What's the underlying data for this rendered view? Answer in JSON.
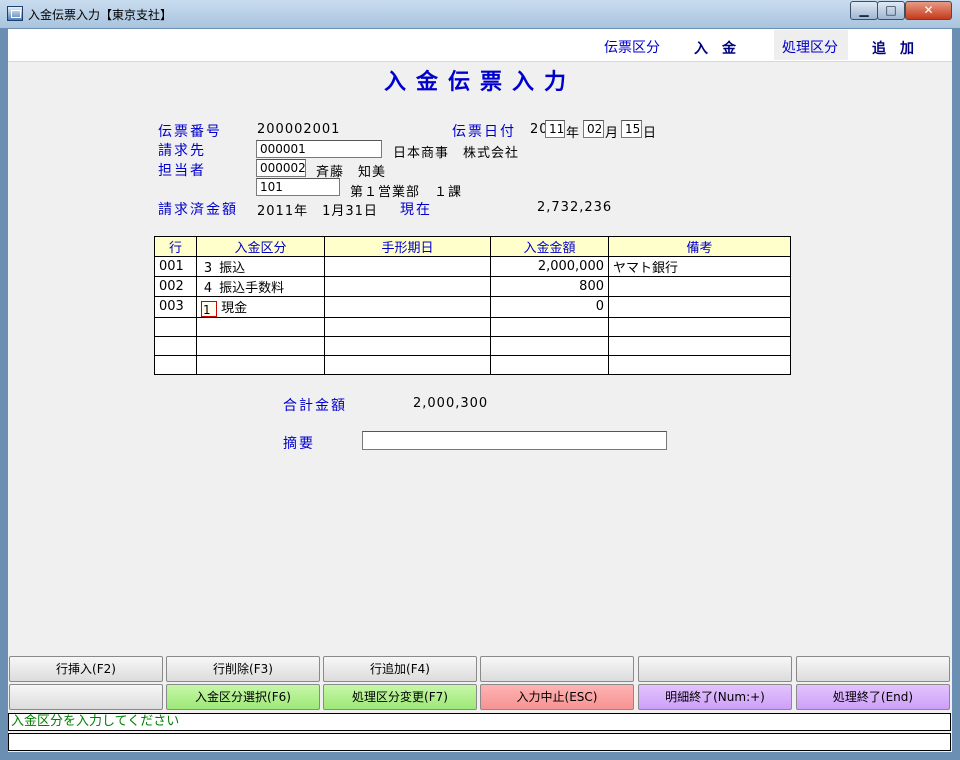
{
  "window": {
    "title": "入金伝票入力【東京支社】",
    "min_glyph": "▁",
    "max_glyph": "□",
    "close_glyph": "✕"
  },
  "header": {
    "slip_kind_label": "伝票区分",
    "slip_kind_value": "入金",
    "proc_kind_label": "処理区分",
    "proc_kind_value": "追加"
  },
  "page_title": "入金伝票入力",
  "form": {
    "slip_no_label": "伝票番号",
    "slip_no": "200002001",
    "slip_date_label": "伝票日付",
    "date_prefix": "20",
    "year": "11",
    "year_unit": "年",
    "month": "02",
    "month_unit": "月",
    "day": "15",
    "day_unit": "日",
    "billing_label": "請求先",
    "billing_code": "000001",
    "billing_name": "日本商事　株式会社",
    "staff_label": "担当者",
    "staff_code": "000002",
    "staff_name": "斉藤　知美",
    "dept_code": "101",
    "dept_name": "第１営業部　１課",
    "billed_label": "請求済金額",
    "billed_date": "2011年　1月31日",
    "current_label": "現在",
    "billed_amount": "2,732,236"
  },
  "table": {
    "headers": [
      "行",
      "入金区分",
      "手形期日",
      "入金金額",
      "備考"
    ],
    "rows": [
      {
        "line": "001",
        "kubun_code": "3",
        "kubun_name": "振込",
        "due": "",
        "amount": "2,000,000",
        "note": "ヤマト銀行"
      },
      {
        "line": "002",
        "kubun_code": "4",
        "kubun_name": "振込手数料",
        "due": "",
        "amount": "800",
        "note": ""
      },
      {
        "line": "003",
        "kubun_code": "1",
        "kubun_name": "現金",
        "due": "",
        "amount": "0",
        "note": ""
      }
    ]
  },
  "total_label": "合計金額",
  "total_value": "2,000,300",
  "memo_label": "摘要",
  "memo_value": "",
  "buttons_row1": [
    "行挿入(F2)",
    "行削除(F3)",
    "行追加(F4)",
    "",
    "",
    ""
  ],
  "buttons_row2": [
    "",
    "入金区分選択(F6)",
    "処理区分変更(F7)",
    "入力中止(ESC)",
    "明細終了(Num:+)",
    "処理終了(End)"
  ],
  "status_message": "入金区分を入力してください",
  "colors": {
    "label_blue": "#0000cc",
    "status_green": "#008000",
    "select_green": "#9ee878",
    "cancel_red": "#f59393",
    "end_purple": "#cda0f7"
  }
}
